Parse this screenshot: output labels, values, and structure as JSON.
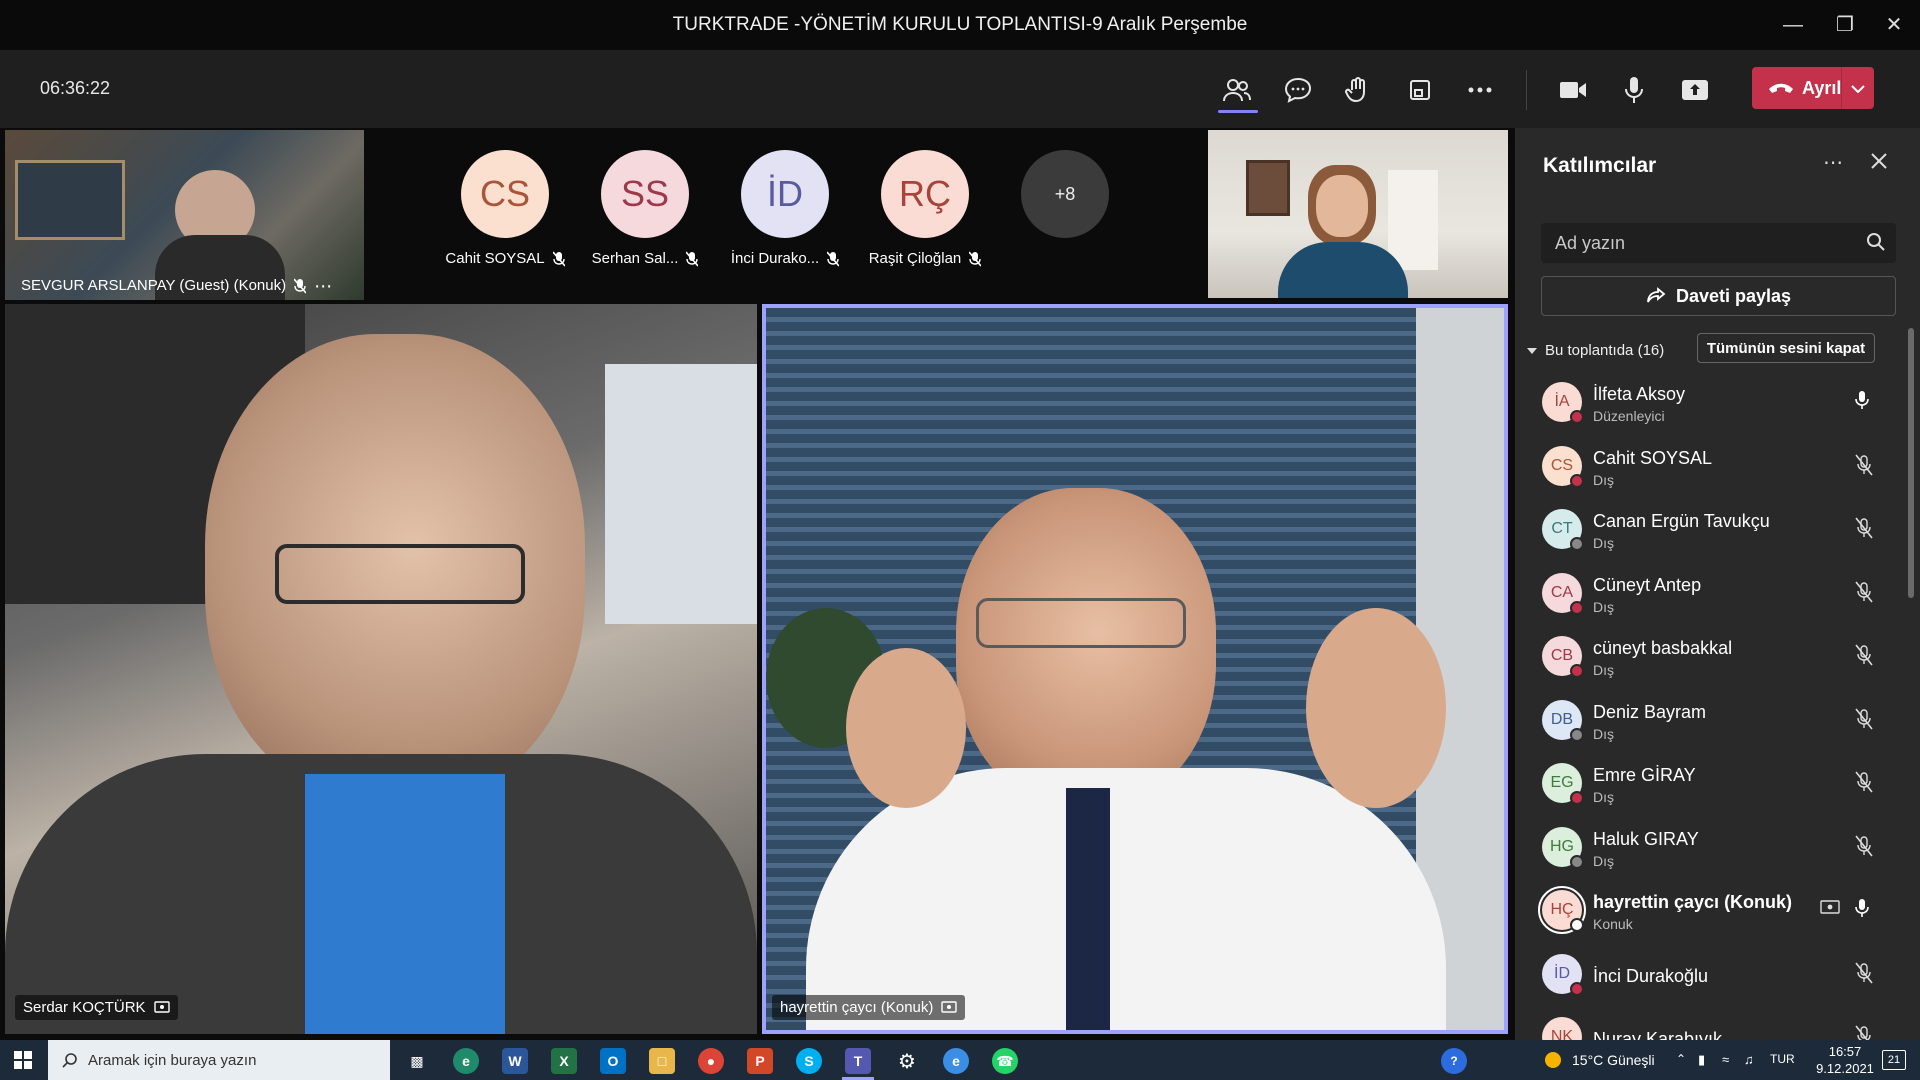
{
  "window": {
    "title": "TURKTRADE -YÖNETİM KURULU TOPLANTISI-9 Aralık Perşembe"
  },
  "toolbar": {
    "timer": "06:36:22",
    "leave_label": "Ayrıl"
  },
  "stage": {
    "top_left_tag": "SEVGUR ARSLANPAY (Guest) (Konuk)",
    "left_tag": "Serdar KOÇTÜRK",
    "right_tag": "hayrettin çaycı (Konuk)",
    "avatars": [
      {
        "initials": "CS",
        "name": "Cahit SOYSAL",
        "bg": "#fbe0cf",
        "fg": "#a8553a"
      },
      {
        "initials": "SS",
        "name": "Serhan Sal...",
        "bg": "#f6d9dd",
        "fg": "#9c3a4c"
      },
      {
        "initials": "İD",
        "name": "İnci Durako...",
        "bg": "#e3e2f5",
        "fg": "#5a5a9e"
      },
      {
        "initials": "RÇ",
        "name": "Raşit Çiloğlan",
        "bg": "#fbdcd4",
        "fg": "#a8433a"
      }
    ],
    "more_count": "+8"
  },
  "panel": {
    "title": "Katılımcılar",
    "search_placeholder": "Ad yazın",
    "share_label": "Daveti paylaş",
    "section_label": "Bu toplantıda (16)",
    "mute_all_label": "Tümünün sesini kapat",
    "participants": [
      {
        "initials": "İA",
        "name": "İlfeta Aksoy",
        "role": "Düzenleyici",
        "bg": "#fbdcd4",
        "fg": "#a8433a",
        "dot": "#c4314b",
        "mic": "on"
      },
      {
        "initials": "CS",
        "name": "Cahit SOYSAL",
        "role": "Dış",
        "bg": "#fbe0cf",
        "fg": "#a8553a",
        "dot": "#c4314b",
        "mic": "muted"
      },
      {
        "initials": "CT",
        "name": "Canan Ergün Tavukçu",
        "role": "Dış",
        "bg": "#d6ecec",
        "fg": "#3a7a7a",
        "dot": "#888888",
        "mic": "muted"
      },
      {
        "initials": "CA",
        "name": "Cüneyt Antep",
        "role": "Dış",
        "bg": "#f6d9dd",
        "fg": "#9c3a4c",
        "dot": "#c4314b",
        "mic": "muted"
      },
      {
        "initials": "CB",
        "name": "cüneyt basbakkal",
        "role": "Dış",
        "bg": "#f6d9dd",
        "fg": "#9c3a4c",
        "dot": "#c4314b",
        "mic": "muted"
      },
      {
        "initials": "DB",
        "name": "Deniz Bayram",
        "role": "Dış",
        "bg": "#dde7f5",
        "fg": "#3f5f90",
        "dot": "#888888",
        "mic": "muted"
      },
      {
        "initials": "EG",
        "name": "Emre GİRAY",
        "role": "Dış",
        "bg": "#dcefdc",
        "fg": "#3f7a3f",
        "dot": "#c4314b",
        "mic": "muted"
      },
      {
        "initials": "HG",
        "name": "Haluk GIRAY",
        "role": "Dış",
        "bg": "#dcefdc",
        "fg": "#3f7a3f",
        "dot": "#888888",
        "mic": "muted"
      },
      {
        "initials": "HÇ",
        "name": "hayrettin çaycı (Konuk)",
        "role": "Konuk",
        "bg": "#fbdcd4",
        "fg": "#a8433a",
        "dot": "#ffffff",
        "mic": "on",
        "selected": true
      },
      {
        "initials": "İD",
        "name": "İnci Durakoğlu",
        "role": "",
        "bg": "#e3e2f5",
        "fg": "#5a5a9e",
        "dot": "#c4314b",
        "mic": "muted"
      },
      {
        "initials": "NK",
        "name": "Nuray Karabıyık",
        "role": "",
        "bg": "#fbdcd4",
        "fg": "#a8433a",
        "dot": "#c4314b",
        "mic": "muted"
      }
    ]
  },
  "taskbar": {
    "search_placeholder": "Aramak için buraya yazın",
    "weather": "15°C  Güneşli",
    "lang": "TUR",
    "time": "16:57",
    "date": "9.12.2021",
    "notif": "21"
  }
}
